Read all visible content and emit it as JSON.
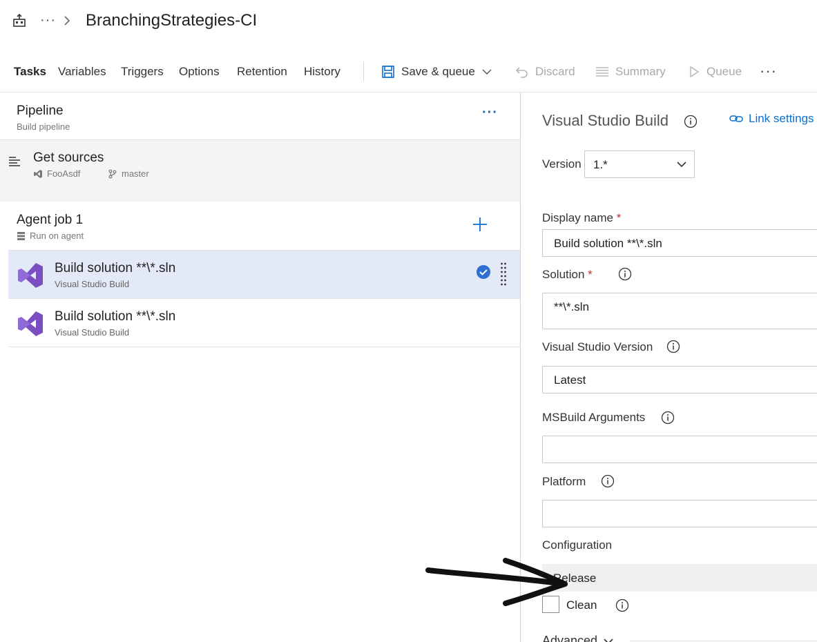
{
  "header": {
    "breadcrumb_more": "···",
    "pipeline_name": "BranchingStrategies-CI"
  },
  "tabs": [
    {
      "label": "Tasks",
      "active": true
    },
    {
      "label": "Variables"
    },
    {
      "label": "Triggers"
    },
    {
      "label": "Options"
    },
    {
      "label": "Retention"
    },
    {
      "label": "History"
    }
  ],
  "toolbar": {
    "save_queue": "Save & queue",
    "discard": "Discard",
    "summary": "Summary",
    "queue": "Queue",
    "more": "···"
  },
  "pipeline": {
    "title": "Pipeline",
    "subtitle": "Build pipeline",
    "more": "···"
  },
  "get_sources": {
    "title": "Get sources",
    "repo": "FooAsdf",
    "branch": "master"
  },
  "agent_job": {
    "title": "Agent job 1",
    "subtitle": "Run on agent"
  },
  "tasks": [
    {
      "title": "Build solution **\\*.sln",
      "subtitle": "Visual Studio Build",
      "selected": true
    },
    {
      "title": "Build solution **\\*.sln",
      "subtitle": "Visual Studio Build",
      "selected": false
    }
  ],
  "details": {
    "title": "Visual Studio Build",
    "link_settings": "Link settings",
    "version_label": "Version",
    "version_value": "1.*",
    "display_name_label": "Display name",
    "display_name_value": "Build solution **\\*.sln",
    "solution_label": "Solution",
    "solution_value": "**\\*.sln",
    "vs_version_label": "Visual Studio Version",
    "vs_version_value": "Latest",
    "msbuild_args_label": "MSBuild Arguments",
    "msbuild_args_value": "",
    "platform_label": "Platform",
    "platform_value": "",
    "configuration_label": "Configuration",
    "configuration_value": "Release",
    "clean_label": "Clean",
    "clean_checked": false,
    "advanced_label": "Advanced",
    "required_mark": "*"
  },
  "colors": {
    "accent": "#0a6ecf",
    "vs_purple": "#7b4fc2",
    "selected_row": "#e3e9f6",
    "required": "#c8312c"
  }
}
